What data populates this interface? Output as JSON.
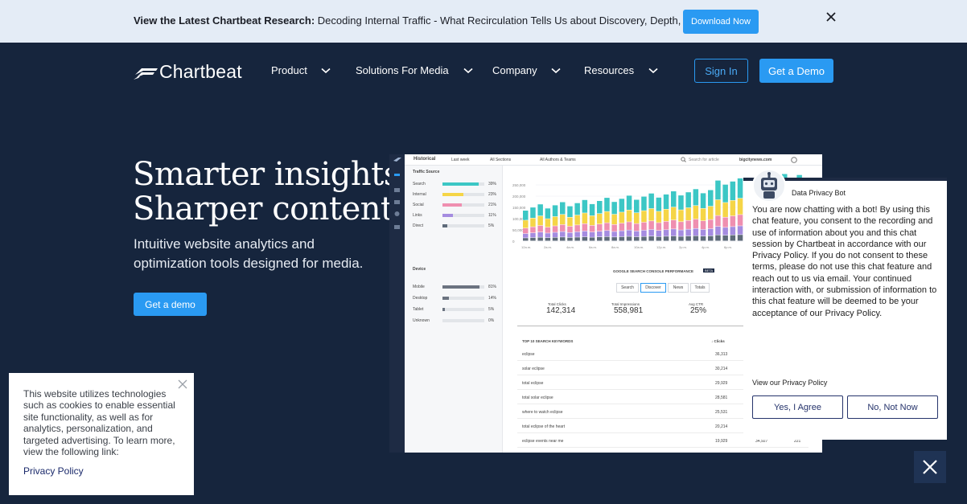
{
  "announcement": {
    "bold": "View the Latest Chartbeat Research:",
    "text": "Decoding Internal Traffic - What Recirculation Tells Us about Discovery, Depth, and Loyalty",
    "button": "Download Now"
  },
  "nav": {
    "logo": "Chartbeat",
    "items": [
      {
        "label": "Product"
      },
      {
        "label": "Solutions For Media"
      },
      {
        "label": "Company"
      },
      {
        "label": "Resources"
      }
    ],
    "sign_in": "Sign In",
    "get_demo": "Get a Demo"
  },
  "hero": {
    "title_line1": "Smarter insights.",
    "title_line2": "Sharper content.",
    "subtitle": "Intuitive website analytics and optimization tools designed for media.",
    "button": "Get a demo"
  },
  "dashboard": {
    "top": {
      "historical": "Historical",
      "range": "Last week",
      "sections": "All Sections",
      "authors": "All Authors & Teams",
      "search": "Search for article",
      "site": "bigcitynews.com"
    },
    "traffic_source": {
      "title": "Traffic Source",
      "rows": [
        {
          "label": "Search",
          "pct": "39%",
          "fill": 0.39,
          "color": "#3cc7c5"
        },
        {
          "label": "Internal",
          "pct": "23%",
          "fill": 0.23,
          "color": "#f5d547"
        },
        {
          "label": "Social",
          "pct": "21%",
          "fill": 0.21,
          "color": "#ef8fb0"
        },
        {
          "label": "Links",
          "pct": "11%",
          "fill": 0.11,
          "color": "#a58ce0"
        },
        {
          "label": "Direct",
          "pct": "5%",
          "fill": 0.05,
          "color": "#5f6b7a"
        }
      ]
    },
    "device": {
      "title": "Device",
      "rows": [
        {
          "label": "Mobile",
          "pct": "81%",
          "fill": 0.81
        },
        {
          "label": "Desktop",
          "pct": "14%",
          "fill": 0.14
        },
        {
          "label": "Tablet",
          "pct": "5%",
          "fill": 0.05
        },
        {
          "label": "Unknown",
          "pct": "0%",
          "fill": 0.0
        }
      ]
    },
    "y_ticks": [
      "250,000",
      "200,000",
      "150,000",
      "100,000",
      "50,000",
      "0"
    ],
    "x_ticks": [
      "12a.m.",
      "2a.m.",
      "4a.m.",
      "6a.m.",
      "8a.m.",
      "10a.m.",
      "12p.m.",
      "2p.m.",
      "4p.m.",
      "6p.m.",
      "8p.m.",
      "10p.m."
    ],
    "gsc": {
      "title": "GOOGLE SEARCH CONSOLE PERFORMANCE",
      "badge": "BETA",
      "tabs": [
        "Search",
        "Discover",
        "News",
        "Totals"
      ],
      "total_clicks_label": "Total Clicks",
      "total_clicks": "142,314",
      "total_impr_label": "Total Impressions",
      "total_impr": "558,981",
      "avg_ctr_label": "Avg CTR",
      "avg_ctr": "25%"
    },
    "keywords": {
      "title": "TOP 10 SEARCH KEYWORDS",
      "clicks_label": "↓ Clicks",
      "rows": [
        {
          "kw": "eclipse",
          "clicks": "36,313"
        },
        {
          "kw": "solar eclipse",
          "clicks": "30,214"
        },
        {
          "kw": "total eclipse",
          "clicks": "29,929"
        },
        {
          "kw": "total solar eclipse",
          "clicks": "28,581"
        },
        {
          "kw": "where to watch eclipse",
          "clicks": "25,531"
        },
        {
          "kw": "total eclipse of the heart",
          "clicks": "20,214"
        },
        {
          "kw": "eclipse events near me",
          "clicks": "19,929",
          "impr": "34,927",
          "pos": "221"
        }
      ]
    }
  },
  "cookie": {
    "text": "This website utilizes technologies such as cookies to enable essential site functionality, as well as for analytics, personalization, and targeted advertising. To learn more, view the following link:",
    "link": "Privacy Policy"
  },
  "chat": {
    "bot_name": "Data Privacy Bot",
    "message": "You are now chatting with a bot! By using this chat feature, you consent to the recording and use of information about you and this chat session by Chartbeat in accordance with our Privacy Policy. If you do not consent to these terms, please do not use this chat feature and reach out to us via email. Your continued interaction with, or submission of information to this chat feature will be deemed to be your acceptance of our Privacy Policy.",
    "view_policy": "View our Privacy Policy",
    "agree": "Yes, I Agree",
    "decline": "No, Not Now"
  },
  "colors": {
    "bg": "#16253d",
    "accent": "#2a9af2",
    "announce_bg": "#e4ecf6"
  },
  "icons": [
    "close-icon",
    "chevron-down-icon",
    "chartbeat-logo-icon",
    "robot-avatar-icon",
    "search-icon",
    "help-icon"
  ]
}
